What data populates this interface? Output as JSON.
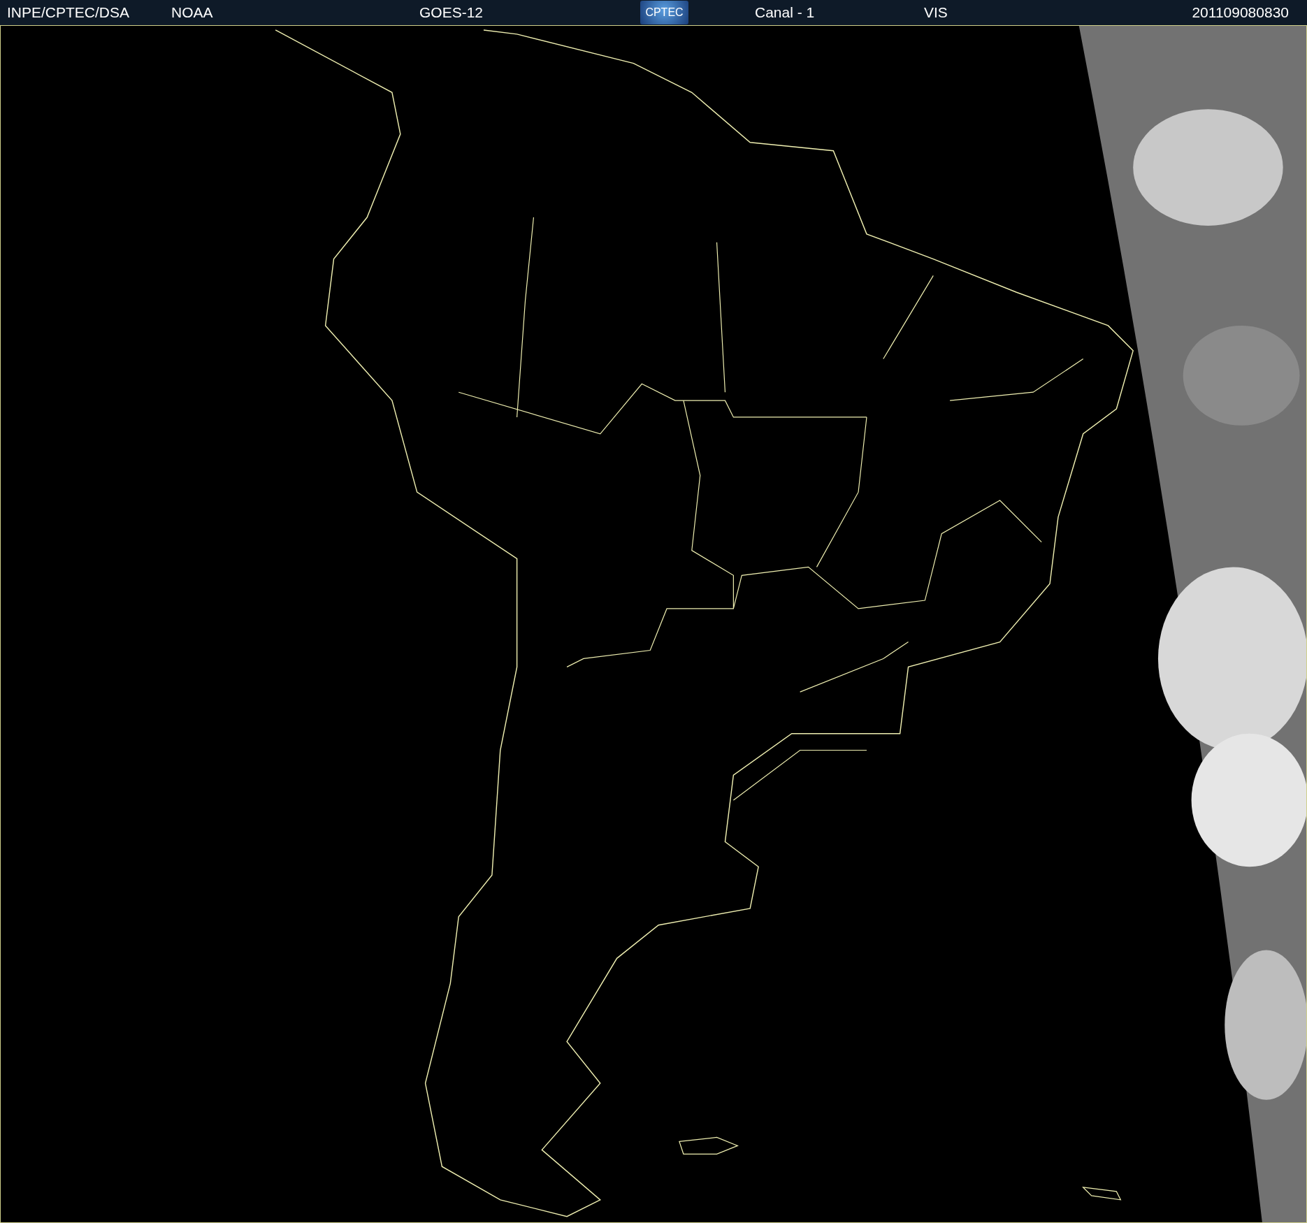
{
  "header": {
    "source": "INPE/CPTEC/DSA",
    "agency": "NOAA",
    "satellite": "GOES-12",
    "logo": "CPTEC",
    "channel": "Canal - 1",
    "band": "VIS",
    "timestamp": "201109080830"
  }
}
